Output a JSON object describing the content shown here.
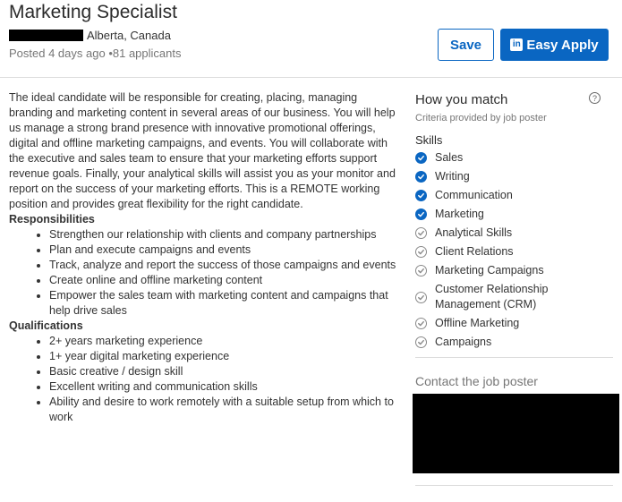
{
  "job": {
    "title": "Marketing Specialist",
    "location": "Alberta, Canada",
    "posted": "Posted 4 days ago",
    "applicants": "•81 applicants"
  },
  "actions": {
    "save_label": "Save",
    "apply_label": "Easy Apply"
  },
  "description": {
    "intro": "The ideal candidate will be responsible for creating, placing, managing branding and marketing content in several areas of our business. You will help us manage a strong brand presence with innovative promotional offerings, digital and offline marketing campaigns, and events. You will collaborate with the executive and sales team to ensure that your marketing efforts support revenue goals. Finally, your analytical skills will assist you as your monitor and report on the success of your marketing efforts. This is a REMOTE working position and provides great flexibility for the right candidate.",
    "responsibilities_heading": "Responsibilities",
    "responsibilities": [
      "Strengthen our relationship with clients and company partnerships",
      "Plan and execute campaigns and events",
      "Track, analyze and report the success of those campaigns and events",
      "Create online and offline marketing content",
      "Empower the sales team with marketing content and campaigns that help drive sales"
    ],
    "qualifications_heading": "Qualifications",
    "qualifications": [
      "2+ years marketing experience",
      "1+ year digital marketing experience",
      "Basic creative / design skill",
      "Excellent writing and communication skills",
      "Ability and desire to work remotely with a suitable setup from which to work"
    ]
  },
  "match": {
    "title": "How you match",
    "criteria": "Criteria provided by job poster",
    "skills_heading": "Skills",
    "skills": [
      {
        "label": "Sales",
        "matched": true
      },
      {
        "label": "Writing",
        "matched": true
      },
      {
        "label": "Communication",
        "matched": true
      },
      {
        "label": "Marketing",
        "matched": true
      },
      {
        "label": "Analytical Skills",
        "matched": false
      },
      {
        "label": "Client Relations",
        "matched": false
      },
      {
        "label": "Marketing Campaigns",
        "matched": false
      },
      {
        "label": "Customer Relationship Management (CRM)",
        "matched": false
      },
      {
        "label": "Offline Marketing",
        "matched": false
      },
      {
        "label": "Campaigns",
        "matched": false
      }
    ]
  },
  "contact": {
    "heading": "Contact the job poster"
  },
  "icons": {
    "help": "help-circle-icon",
    "apply": "linkedin-icon",
    "check": "check-circle-icon"
  },
  "colors": {
    "accent": "#0a66c2",
    "muted": "#767676"
  }
}
